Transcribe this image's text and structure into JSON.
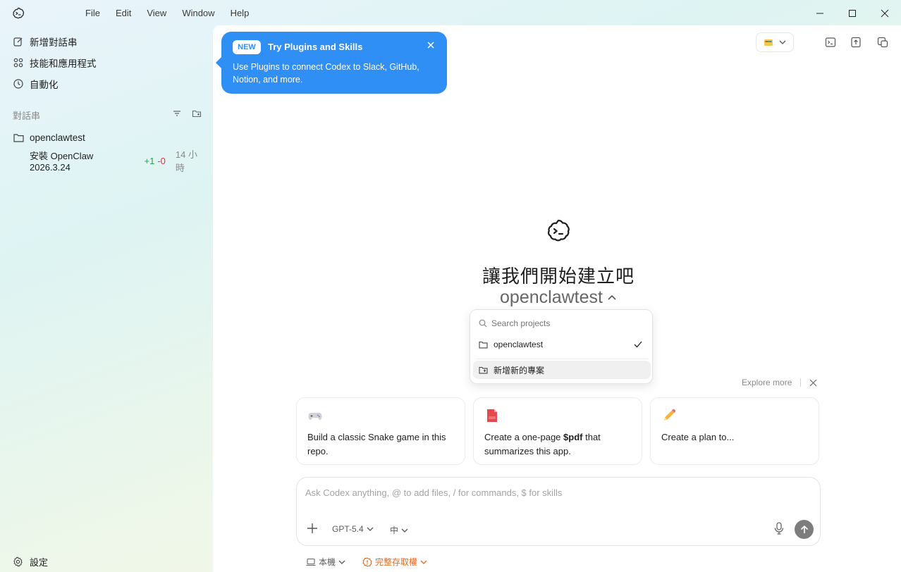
{
  "menu": [
    "File",
    "Edit",
    "View",
    "Window",
    "Help"
  ],
  "sidebar": {
    "items": [
      {
        "label": "新增對話串",
        "icon": "edit-icon"
      },
      {
        "label": "技能和應用程式",
        "icon": "grid-icon"
      },
      {
        "label": "自動化",
        "icon": "clock-icon"
      }
    ],
    "section_title": "對話串",
    "project": "openclawtest",
    "thread": {
      "title": "安裝 OpenClaw 2026.3.24",
      "added": "+1",
      "removed": "-0",
      "time": "14 小時"
    },
    "settings": "設定"
  },
  "popup": {
    "badge": "NEW",
    "title": "Try Plugins and Skills",
    "body": "Use Plugins to connect Codex to Slack, GitHub, Notion, and more."
  },
  "main": {
    "heading": "讓我們開始建立吧",
    "project": "openclawtest"
  },
  "dropdown": {
    "search_placeholder": "Search projects",
    "project": "openclawtest",
    "new_project": "新增新的專案"
  },
  "explore": {
    "label": "Explore more"
  },
  "cards": [
    {
      "icon": "game-controller-icon",
      "text_pre": "Build a classic Snake game in this repo.",
      "bold": "",
      "text_post": ""
    },
    {
      "icon": "pdf-icon",
      "text_pre": "Create a one-page ",
      "bold": "$pdf",
      "text_post": " that summarizes this app."
    },
    {
      "icon": "pencil-icon",
      "text_pre": "Create a plan to...",
      "bold": "",
      "text_post": ""
    }
  ],
  "composer": {
    "placeholder": "Ask Codex anything, @ to add files, / for commands, $ for skills",
    "model": "GPT-5.4",
    "effort": "中",
    "env": "本機",
    "permission": "完整存取權"
  },
  "colors": {
    "accent": "#2f8ff5",
    "added": "#2e9d4c",
    "removed": "#d9363e",
    "warning": "#e36a1c"
  }
}
